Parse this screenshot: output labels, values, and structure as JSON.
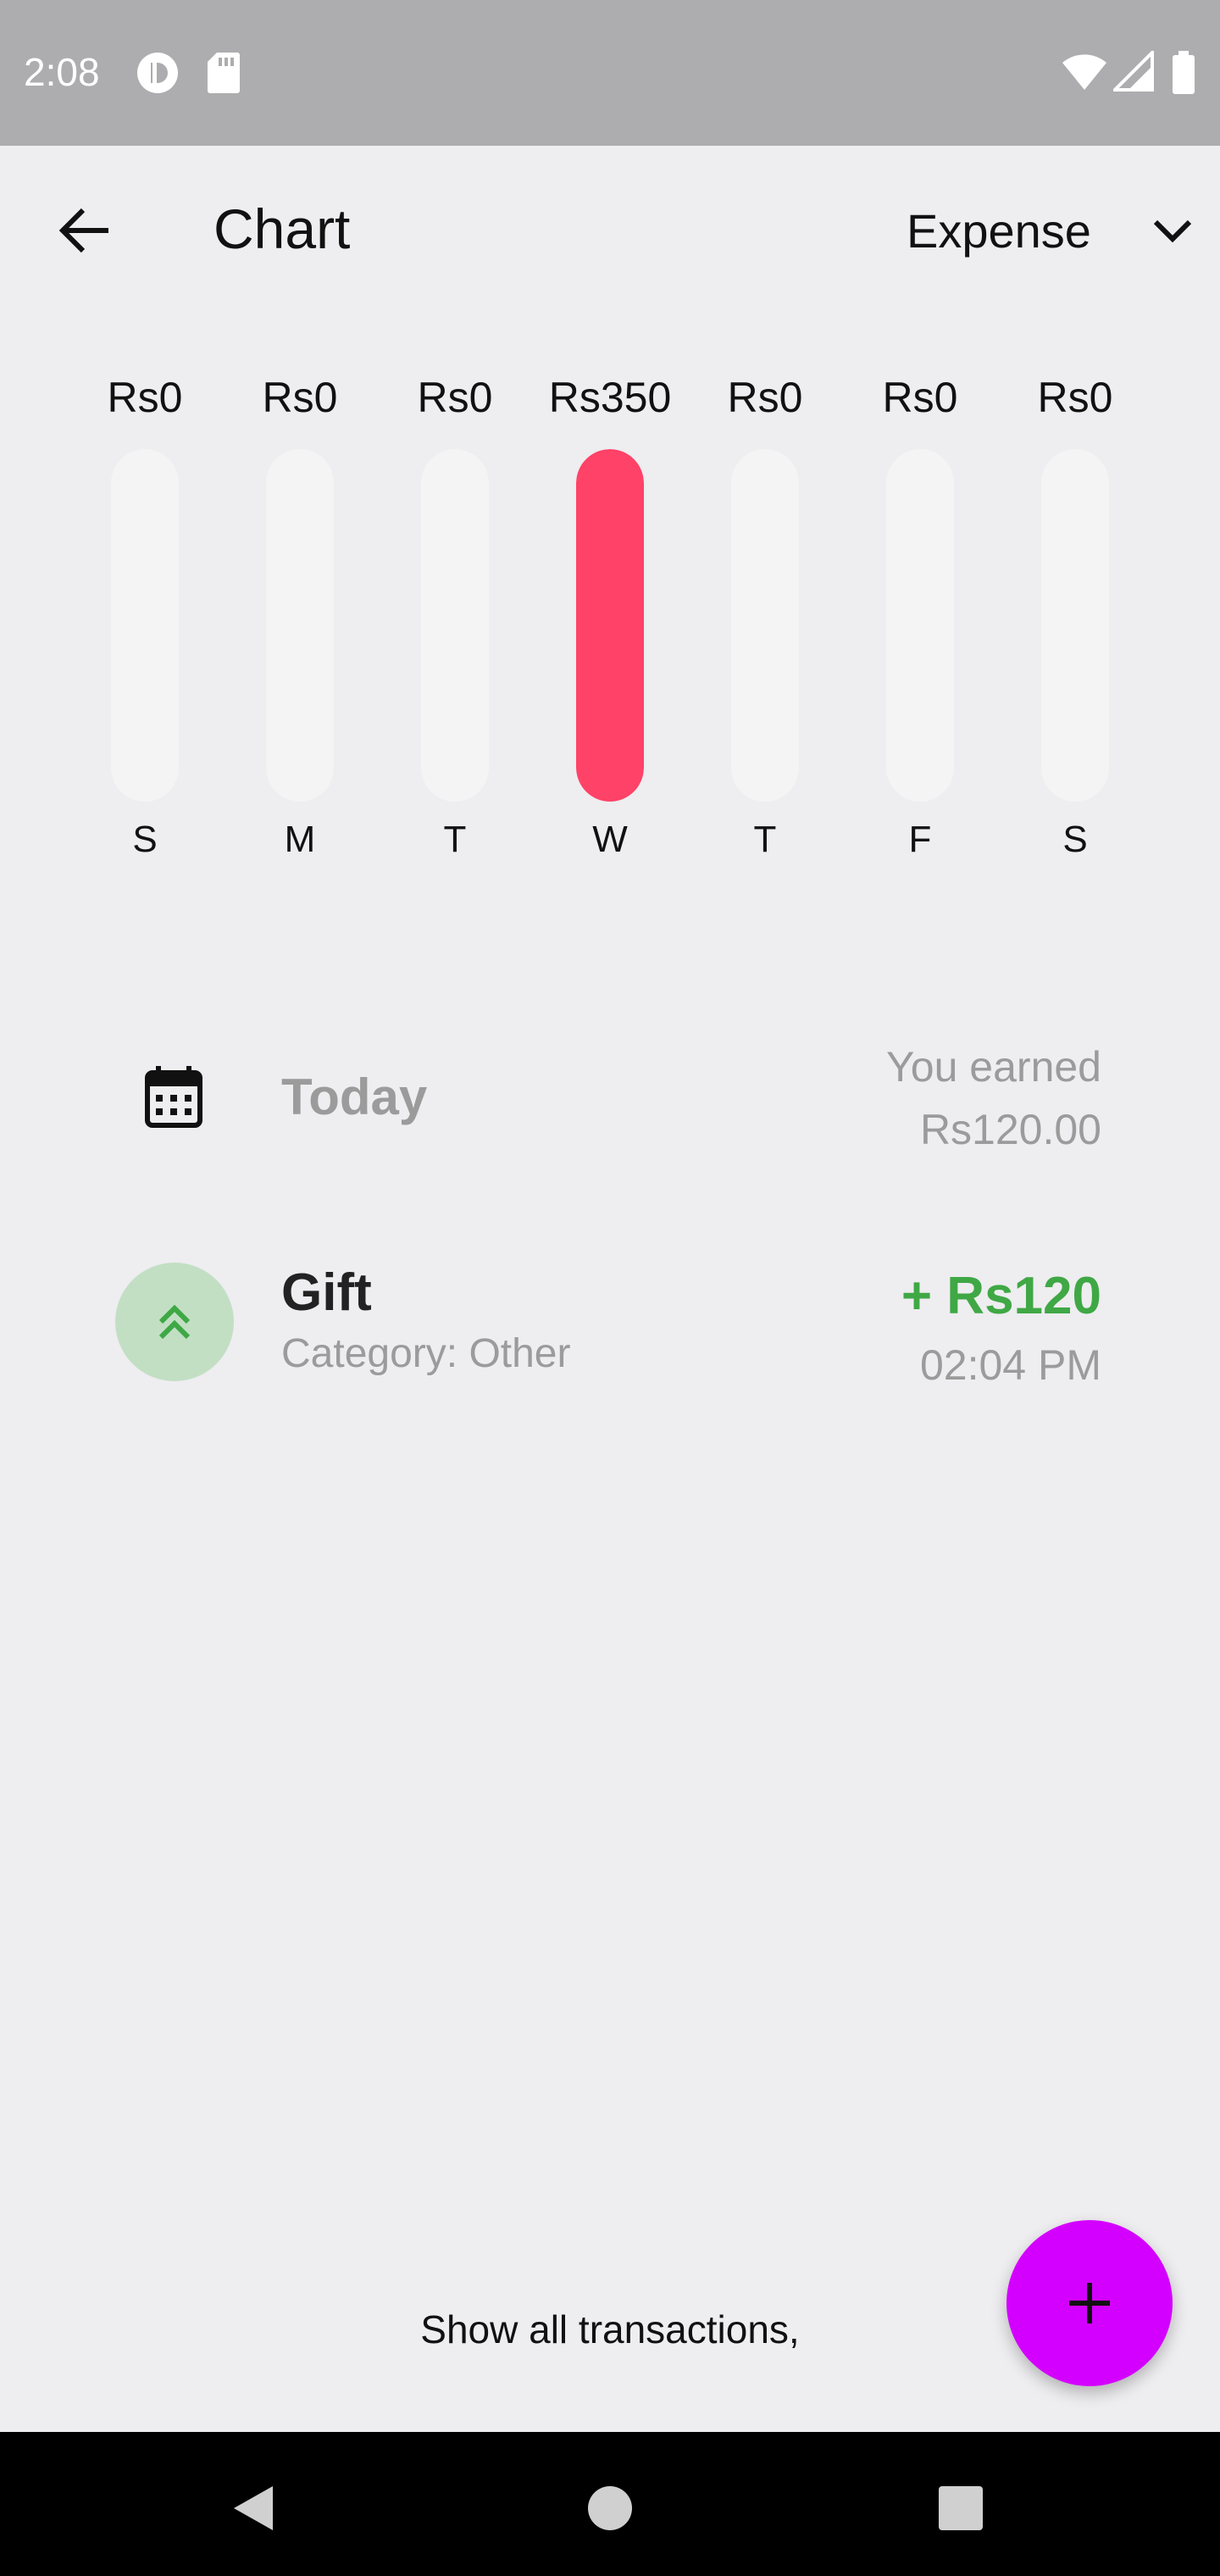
{
  "status_bar": {
    "time": "2:08"
  },
  "header": {
    "title": "Chart",
    "type_selected": "Expense"
  },
  "chart_data": {
    "type": "bar",
    "categories": [
      "S",
      "M",
      "T",
      "W",
      "T",
      "F",
      "S"
    ],
    "values": [
      0,
      0,
      0,
      350,
      0,
      0,
      0
    ],
    "value_labels": [
      "Rs0",
      "Rs0",
      "Rs0",
      "Rs350",
      "Rs0",
      "Rs0",
      "Rs0"
    ],
    "bar_color": "#ff4267",
    "track_color": "#f4f4f4",
    "grid": false,
    "title": ""
  },
  "summary": {
    "label": "Today",
    "earned_label": "You earned",
    "earned_amount": "Rs120.00"
  },
  "transactions": [
    {
      "name": "Gift",
      "category": "Category: Other",
      "amount": "+ Rs120",
      "time": "02:04 PM",
      "icon": "double-chevron-up-icon",
      "amount_color": "#3fa845"
    }
  ],
  "footer": {
    "show_all": "Show all transactions,"
  },
  "colors": {
    "accent_fab": "#d400ff",
    "income": "#3fa845",
    "expense_bar": "#ff4267"
  }
}
